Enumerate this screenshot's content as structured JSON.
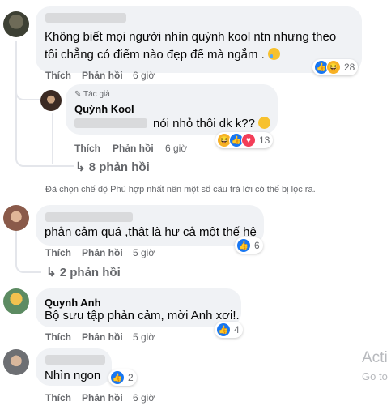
{
  "actions": {
    "like": "Thích",
    "reply": "Phản hồi"
  },
  "comment1": {
    "line1": "Không biết mọi người nhìn quỳnh kool ntn nhưng theo",
    "line2": "tôi chẳng có điểm nào đẹp để mà ngắm .",
    "emoji_icon": "crying-face",
    "time": "6 giờ",
    "reaction_count": "28",
    "reactions": [
      "like",
      "haha"
    ]
  },
  "reply1": {
    "author_badge": "Tác giả",
    "author": "Quỳnh Kool",
    "text": "nói nhỏ thôi dk k??",
    "emoji_icon": "shushing-face",
    "time": "6 giờ",
    "reaction_count": "13",
    "reactions": [
      "haha",
      "like",
      "love"
    ]
  },
  "more_replies1": "8 phản hồi",
  "filter_notice": "Đã chọn chế độ Phù hợp nhất nên một số câu trả lời có thể bị lọc ra.",
  "comment2": {
    "text": "phản cảm quá ,thật là hư cả một thế hệ",
    "time": "5 giờ",
    "reaction_count": "6"
  },
  "more_replies2": "2 phản hồi",
  "comment3": {
    "author": "Quynh Anh",
    "text": "Bộ sưu tập phản cảm, mời Anh xơi!.",
    "time": "5 giờ",
    "reaction_count": "4"
  },
  "comment4": {
    "text": "Nhìn ngon",
    "time": "6 giờ",
    "reaction_count": "2"
  },
  "watermark": {
    "line1": "Acti",
    "line2": "Go to"
  },
  "colors": {
    "like": "#1877f2",
    "haha": "#f7b125",
    "love": "#f33e58",
    "bubble": "#f0f2f5",
    "meta": "#65676b"
  }
}
